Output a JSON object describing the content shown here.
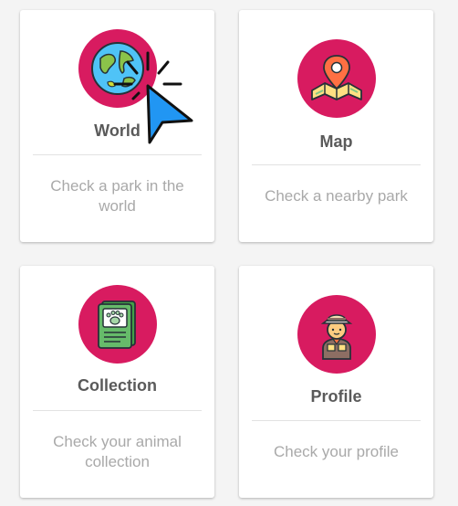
{
  "cards": [
    {
      "title": "World",
      "description": "Check a park in the world",
      "icon": "globe-icon"
    },
    {
      "title": "Map",
      "description": "Check a nearby park",
      "icon": "map-pin-icon"
    },
    {
      "title": "Collection",
      "description": "Check your animal collection",
      "icon": "paw-card-icon"
    },
    {
      "title": "Profile",
      "description": "Check your profile",
      "icon": "explorer-avatar-icon"
    }
  ],
  "colors": {
    "accent": "#d81b60",
    "title_text": "#5a5a5a",
    "description_text": "#a9a9a9",
    "card_background": "#ffffff",
    "page_background": "#f4f4f4",
    "cursor": "#2196f3"
  }
}
